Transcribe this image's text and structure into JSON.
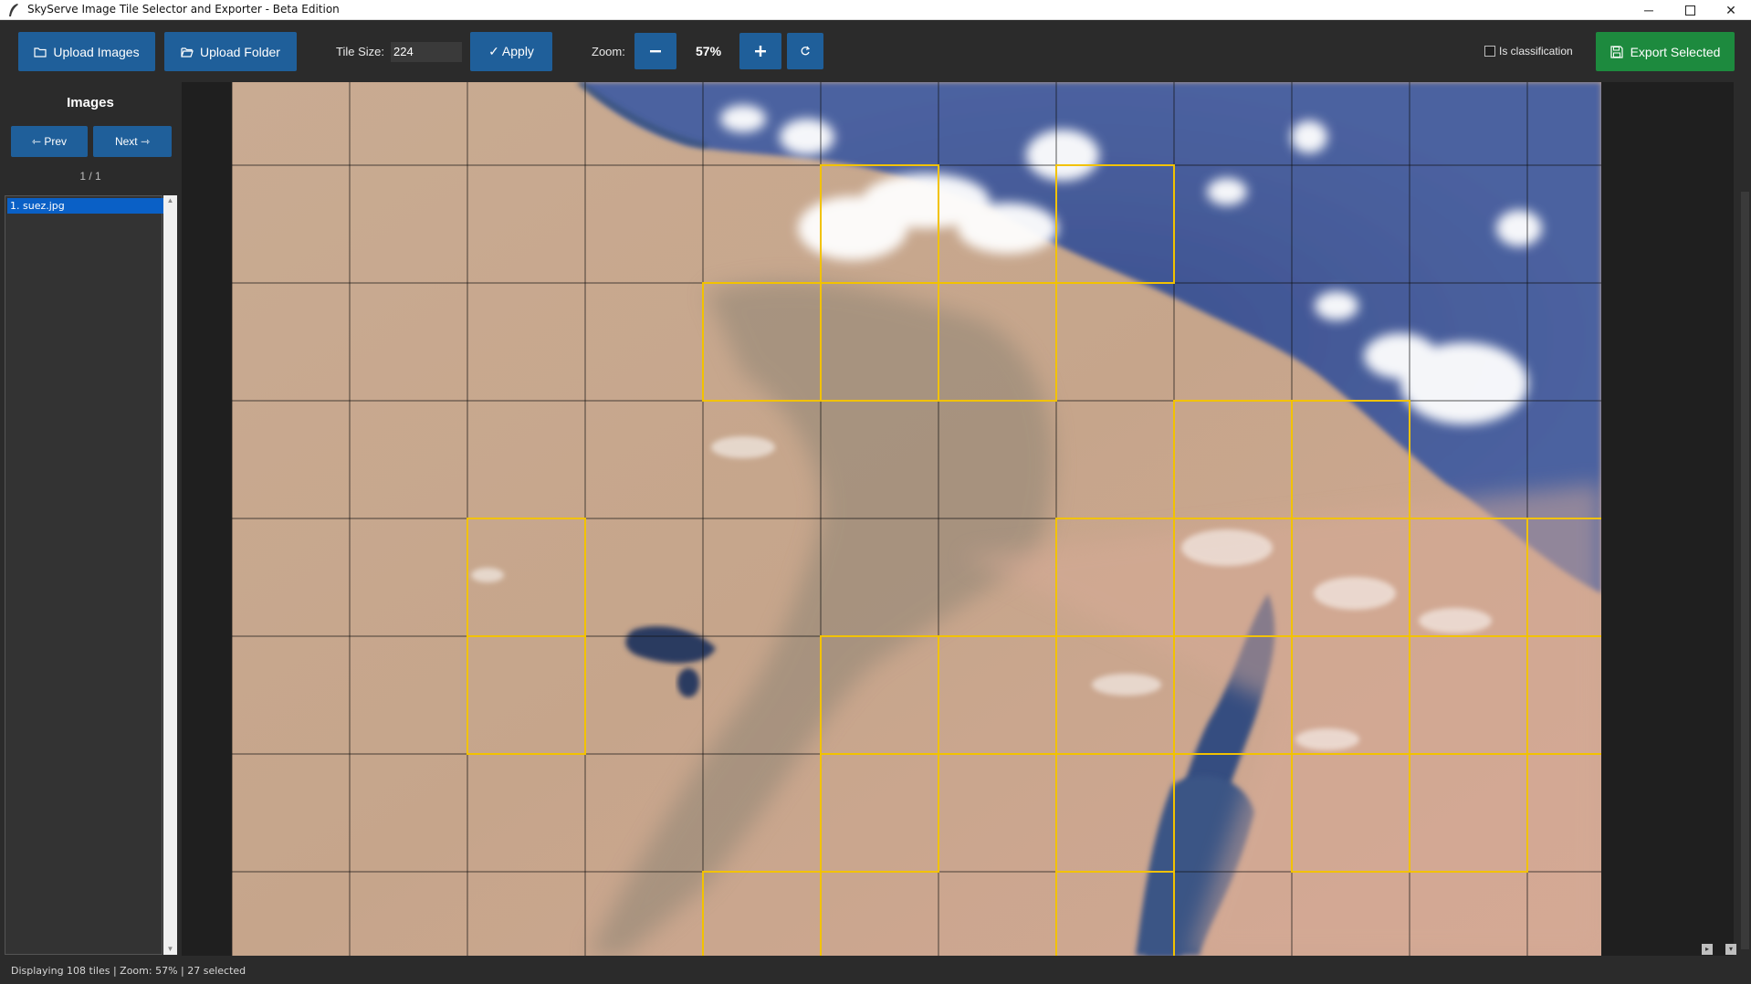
{
  "window": {
    "title": "SkyServe Image Tile Selector and Exporter - Beta Edition",
    "controls": [
      "minimize-icon",
      "maximize-icon",
      "close-icon"
    ]
  },
  "toolbar": {
    "upload_images_label": "Upload Images",
    "upload_folder_label": "Upload Folder",
    "tile_size_label": "Tile Size:",
    "tile_size_value": "224",
    "apply_label": "✓ Apply",
    "zoom_label": "Zoom:",
    "zoom_value": "57%",
    "zoom_out_icon": "minus-icon",
    "zoom_in_icon": "plus-icon",
    "reset_icon": "reset-icon",
    "classification_label": "Is classification",
    "classification_checked": false,
    "export_label": "Export Selected"
  },
  "sidebar": {
    "title": "Images",
    "prev_label": "⇽ Prev",
    "next_label": "Next ⇾",
    "counter": "1 / 1",
    "items": [
      {
        "label": "1. suez.jpg",
        "selected": true
      }
    ]
  },
  "tile_grid": {
    "image": "satellite-image",
    "columns": 12,
    "rows": 8,
    "visible_tiles": 108,
    "selected_tiles": [
      [
        1,
        5
      ],
      [
        1,
        7
      ],
      [
        2,
        4
      ],
      [
        2,
        5
      ],
      [
        2,
        6
      ],
      [
        3,
        8
      ],
      [
        3,
        9
      ],
      [
        4,
        2
      ],
      [
        4,
        7
      ],
      [
        4,
        8
      ],
      [
        4,
        9
      ],
      [
        4,
        10
      ],
      [
        4,
        11
      ],
      [
        5,
        2
      ],
      [
        5,
        5
      ],
      [
        5,
        6
      ],
      [
        5,
        7
      ],
      [
        5,
        8
      ],
      [
        5,
        9
      ],
      [
        5,
        10
      ],
      [
        5,
        11
      ],
      [
        6,
        5
      ],
      [
        6,
        7
      ],
      [
        6,
        9
      ],
      [
        6,
        10
      ],
      [
        7,
        4
      ],
      [
        7,
        7
      ]
    ],
    "grid_color": "#111111",
    "selected_color": "#f2c200"
  },
  "status": {
    "text": "Displaying 108 tiles | Zoom: 57% | 27 selected"
  },
  "colors": {
    "accent": "#1f5f9a",
    "export": "#1d8a3e",
    "background": "#2b2b2b",
    "list_selected": "#0a60c6"
  }
}
